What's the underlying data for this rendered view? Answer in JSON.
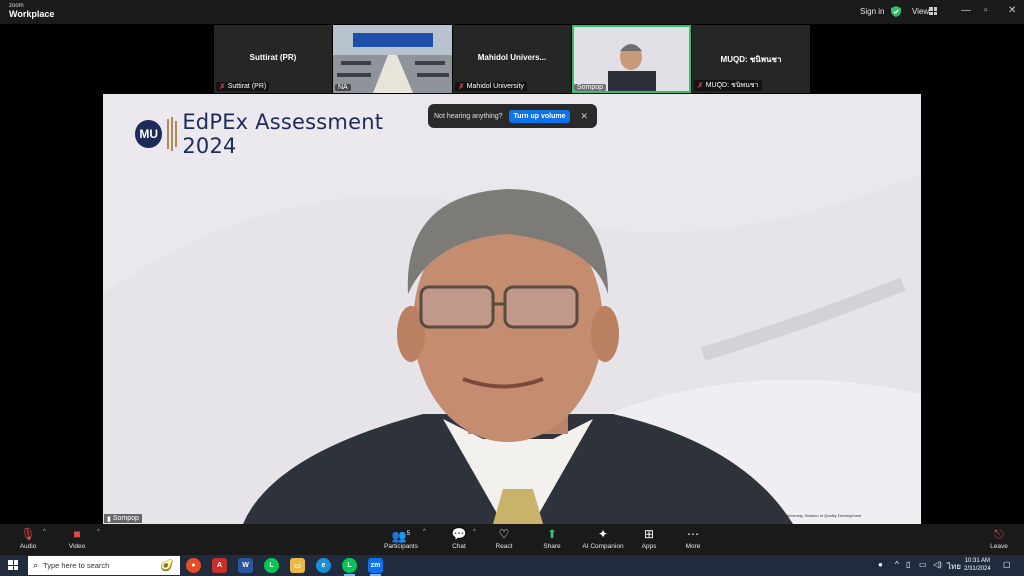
{
  "app": {
    "brand_small": "zoom",
    "brand": "Workplace"
  },
  "header": {
    "signin_label": "Sign in",
    "view_label": "View"
  },
  "thumbnails": [
    {
      "name": "Suttirat (PR)",
      "label": "Suttirat (PR)",
      "muted": true
    },
    {
      "name": "",
      "label": "NA",
      "muted": false
    },
    {
      "name": "Mahidol Univers...",
      "label": "Mahidol University",
      "muted": true
    },
    {
      "name": "",
      "label": "Sompop",
      "muted": false,
      "active": true
    },
    {
      "name": "MUQD: ชนิพนชา",
      "label": "MUQD: ชนิพนชา",
      "muted": true
    }
  ],
  "main_video": {
    "banner_logo": "MU",
    "banner_title": "EdPEx Assessment 2024",
    "speaker_label": "Sompop",
    "footer_text": "Mahidol University, Division of Quality Development"
  },
  "toast": {
    "message": "Not hearing anything?",
    "button_label": "Turn up volume"
  },
  "toolbar": {
    "audio": "Audio",
    "video": "Video",
    "participants": "Participants",
    "participants_count": "5",
    "chat": "Chat",
    "react": "React",
    "share": "Share",
    "ai_companion": "AI Companion",
    "apps": "Apps",
    "more": "More",
    "leave": "Leave"
  },
  "taskbar": {
    "search_placeholder": "Type here to search",
    "language": "ไทย",
    "time": "10:31 AM",
    "date": "2/31/2024"
  },
  "colors": {
    "accent": "#0e72ed",
    "active_border": "#2dc26b",
    "muted_red": "#e5484d",
    "share_green": "#2dc26b"
  }
}
